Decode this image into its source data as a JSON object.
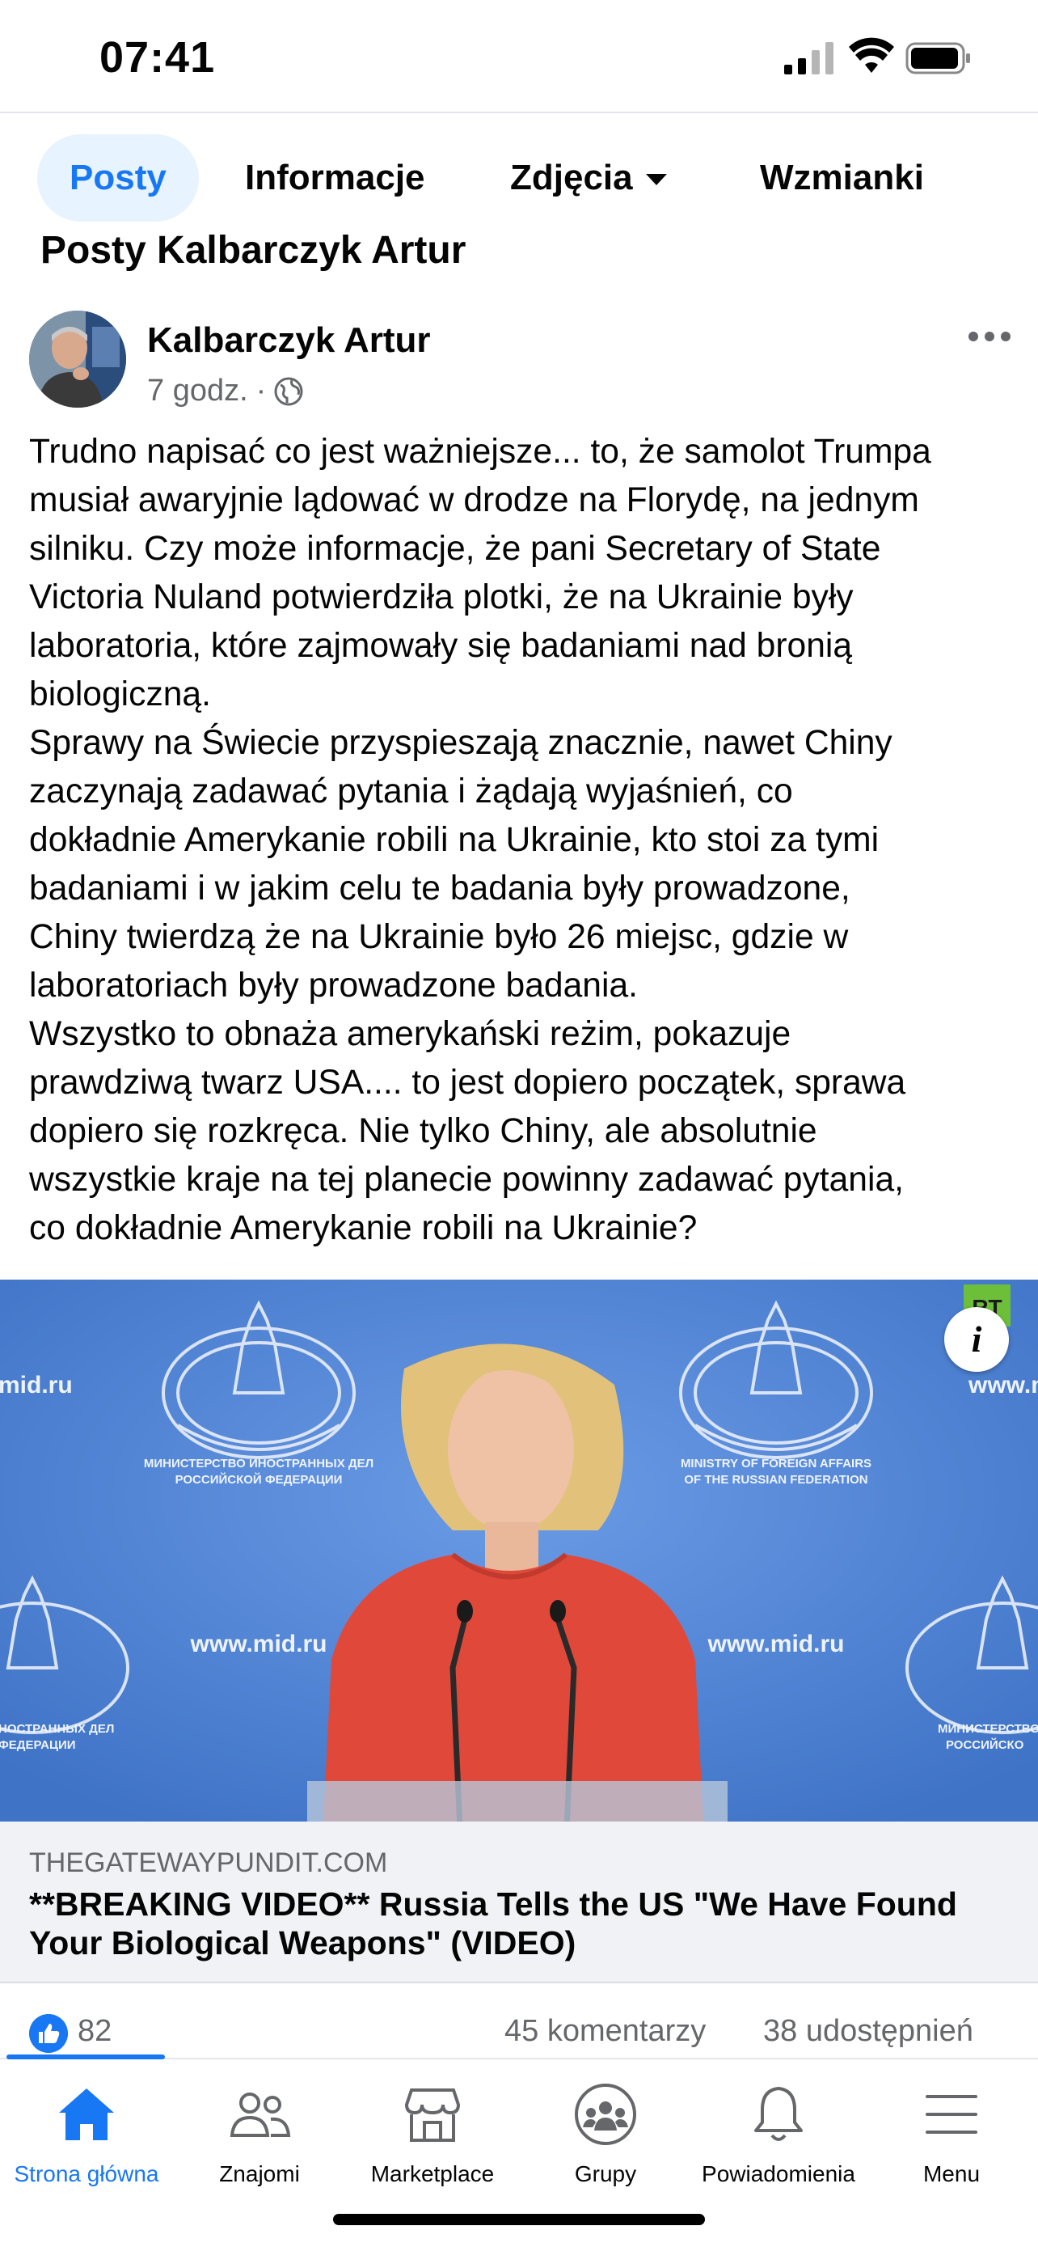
{
  "status_bar": {
    "time": "07:41",
    "icons": [
      "cellular-signal-icon",
      "wifi-icon",
      "battery-icon"
    ]
  },
  "tabs": [
    {
      "label": "Posty",
      "active": true
    },
    {
      "label": "Informacje",
      "active": false
    },
    {
      "label": "Zdjęcia",
      "active": false,
      "has_dropdown": true
    },
    {
      "label": "Wzmianki",
      "active": false
    }
  ],
  "section_title": "Posty Kalbarczyk Artur",
  "post": {
    "author": "Kalbarczyk Artur",
    "time": "7 godz.",
    "separator": "·",
    "audience_icon": "globe-icon",
    "text": "Trudno napisać co jest ważniejsze... to, że samolot Trumpa\nmusiał awaryjnie lądować w drodze na Florydę, na jednym\nsilniku. Czy może informacje, że pani Secretary of State\nVictoria Nuland potwierdziła plotki, że na Ukrainie były\nlaboratoria, które zajmowały się badaniami nad bronią\nbiologiczną.\nSprawy na Świecie przyspieszają znacznie, nawet Chiny\nzaczynają zadawać pytania i żądają wyjaśnień, co\ndokładnie Amerykanie robili na Ukrainie, kto stoi za tymi\nbadaniami i w jakim celu te badania były prowadzone,\nChiny twierdzą że na Ukrainie było 26 miejsc, gdzie w\nlaboratoriach były prowadzone badania.\nWszystko to obnaża amerykański reżim, pokazuje\nprawdziwą twarz USA.... to jest dopiero początek, sprawa\ndopiero się rozkręca. Nie tylko Chiny, ale absolutnie\nwszystkie kraje na tej planecie powinny zadawać pytania,\nco dokładnie Amerykanie robili na Ukrainie?",
    "link": {
      "image_texts": {
        "watermark_left": "mid.ru",
        "watermark_right": "www.m",
        "url_left": "www.mid.ru",
        "url_right": "www.mid.ru",
        "ministry_ru_1": "МИНИСТЕРСТВО ИНОСТРАННЫХ ДЕЛ",
        "ministry_ru_2": "РОССИЙСКОЙ ФЕДЕРАЦИИ",
        "ministry_en_1": "MINISTRY OF FOREIGN AFFAIRS",
        "ministry_en_2": "OF THE RUSSIAN FEDERATION",
        "ministry_ru_left_1": "НОСТРАННЫХ ДЕЛ",
        "ministry_ru_left_2": "ФЕДЕРАЦИИ",
        "ministry_ru_right_1": "МИНИСТЕРСТВО",
        "ministry_ru_right_2": "РОССИЙСКО",
        "channel_badge": "RT"
      },
      "info_label": "i",
      "domain": "THEGATEWAYPUNDIT.COM",
      "title": "**BREAKING VIDEO** Russia Tells the US \"We Have Found Your Biological Weapons\" (VIDEO)"
    },
    "reactions": {
      "like_count": "82",
      "comments": "45 komentarzy",
      "shares": "38 udostępnień"
    }
  },
  "bottom_nav": [
    {
      "label": "Strona główna",
      "icon": "home-icon",
      "active": true
    },
    {
      "label": "Znajomi",
      "icon": "friends-icon",
      "active": false
    },
    {
      "label": "Marketplace",
      "icon": "marketplace-icon",
      "active": false
    },
    {
      "label": "Grupy",
      "icon": "groups-icon",
      "active": false
    },
    {
      "label": "Powiadomienia",
      "icon": "bell-icon",
      "active": false
    },
    {
      "label": "Menu",
      "icon": "menu-icon",
      "active": false
    }
  ],
  "colors": {
    "accent": "#1877f2",
    "secondary_text": "#65676b",
    "tab_active_bg": "#e7f3ff",
    "link_box_bg": "#f0f2f5",
    "image_background": "#4f86d8"
  }
}
